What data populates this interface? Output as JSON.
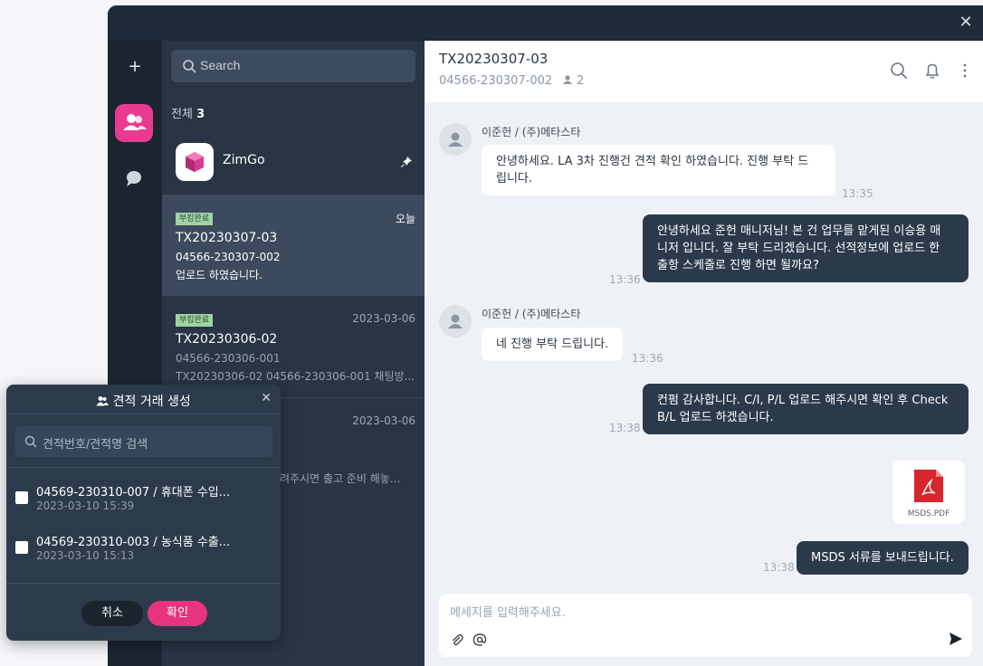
{
  "window": {
    "close_glyph": "✕"
  },
  "rail": {
    "new_label": "+",
    "icons": [
      "people-icon",
      "chat-icon"
    ]
  },
  "list": {
    "search_placeholder": "Search",
    "count_label": "전체",
    "count_value": "3",
    "pinned": {
      "name": "ZimGo",
      "icon": "pin-icon"
    },
    "items": [
      {
        "badge": "부킹완료",
        "date": "오늘",
        "title": "TX20230307-03",
        "sub": "04566-230307-002",
        "msg": "업로드 하였습니다."
      },
      {
        "badge": "부킹완료",
        "date": "2023-03-06",
        "title": "TX20230306-02",
        "sub": "04566-230306-001",
        "msg": "TX20230306-02 04566-230306-001 채팅방..."
      },
      {
        "date": "2023-03-06",
        "msg": "려주시면 출고 준비 해놓..."
      }
    ]
  },
  "chat": {
    "title": "TX20230307-03",
    "subtitle": "04566-230307-002",
    "member_count": "2",
    "header_icons": [
      "search-icon",
      "bell-icon",
      "more-icon"
    ],
    "messages": [
      {
        "dir": "in",
        "sender": "이준헌 / (주)메타스타",
        "text_lines": [
          "안녕하세요. LA 3차 진행건 견적 확인 하였습니다. 진행 부탁 드",
          "립니다."
        ],
        "time": "13:35"
      },
      {
        "dir": "out",
        "text_lines": [
          "안녕하세요 준헌 매니저님! 본 건 업무를 맡게된 이승용 매",
          "니저 입니다. 잘 부탁 드리겠습니다. 선적정보에 업로드 한",
          "출항 스케줄로 진행 하면 될까요?"
        ],
        "time": "13:36"
      },
      {
        "dir": "in",
        "sender": "이준헌 / (주)메타스타",
        "text_lines": [
          "네 진행 부탁 드립니다."
        ],
        "time": "13:36"
      },
      {
        "dir": "out",
        "text_lines": [
          "컨펌 감사합니다. C/I, P/L 업로드 해주시면 확인 후 Check",
          "B/L 업로드 하겠습니다."
        ],
        "time": "13:38"
      },
      {
        "dir": "out",
        "file": "MSDS.PDF",
        "text_lines": [
          "MSDS 서류를 보내드립니다."
        ],
        "time": "13:38"
      }
    ],
    "input_placeholder": "메세지를 입력해주세요.",
    "input_icons": [
      "attach-icon",
      "mention-icon",
      "send-icon"
    ]
  },
  "modal": {
    "title": "견적 거래 생성",
    "close_glyph": "✕",
    "search_placeholder": "견적번호/견적명 검색",
    "rows": [
      {
        "l1": "04569-230310-007 / 휴대폰 수입...",
        "l2": "2023-03-10 15:39"
      },
      {
        "l1": "04569-230310-003 / 농식품 수출...",
        "l2": "2023-03-10 15:13"
      }
    ],
    "cancel_label": "취소",
    "ok_label": "확인"
  },
  "colors": {
    "accent": "#e8337f",
    "bubble_out": "#2b3a4b",
    "badge": "#9fd2a5"
  }
}
